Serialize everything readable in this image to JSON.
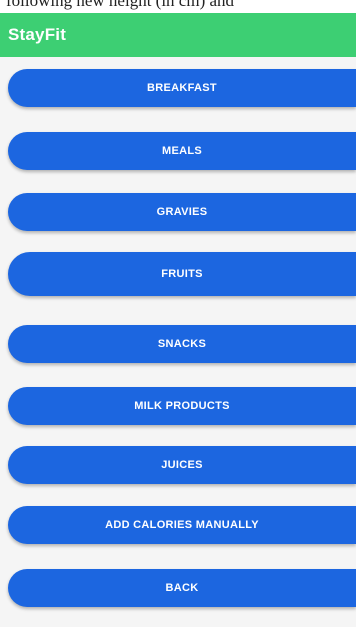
{
  "top_cutoff_text": "following new height (in cm) and",
  "app": {
    "title": "StayFit",
    "colors": {
      "app_bar": "#3dcf73",
      "button": "#1c66e0",
      "background": "#f5f5f5"
    }
  },
  "menu": {
    "buttons": [
      {
        "label": "BREAKFAST"
      },
      {
        "label": "MEALS"
      },
      {
        "label": "GRAVIES"
      },
      {
        "label": "FRUITS"
      },
      {
        "label": "SNACKS"
      },
      {
        "label": "MILK PRODUCTS"
      },
      {
        "label": "JUICES"
      },
      {
        "label": "ADD CALORIES MANUALLY"
      },
      {
        "label": "BACK"
      }
    ]
  }
}
